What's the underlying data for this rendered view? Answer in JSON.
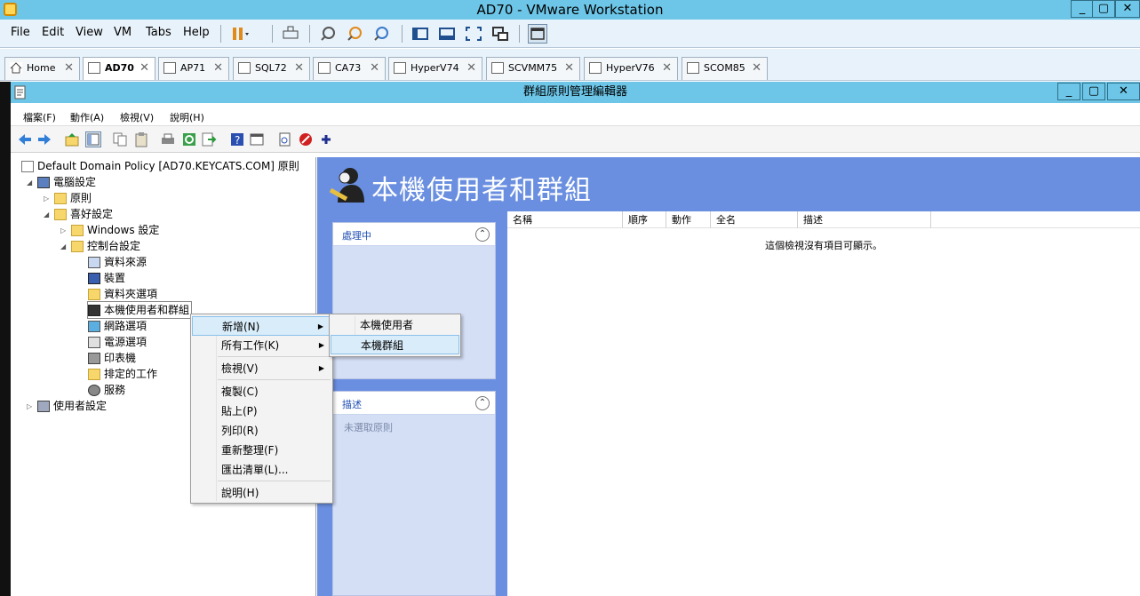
{
  "vmware": {
    "title": "AD70 - VMware Workstation",
    "window_controls": {
      "minimize": "_",
      "restore": "▢",
      "close": "✕"
    },
    "menu": [
      "File",
      "Edit",
      "View",
      "VM",
      "Tabs",
      "Help"
    ],
    "tabs": [
      {
        "label": "Home",
        "active": false
      },
      {
        "label": "AD70",
        "active": true
      },
      {
        "label": "AP71",
        "active": false
      },
      {
        "label": "SQL72",
        "active": false
      },
      {
        "label": "CA73",
        "active": false
      },
      {
        "label": "HyperV74",
        "active": false
      },
      {
        "label": "SCVMM75",
        "active": false
      },
      {
        "label": "HyperV76",
        "active": false
      },
      {
        "label": "SCOM85",
        "active": false
      }
    ],
    "tab_close": "✕"
  },
  "gpme": {
    "title": "群組原則管理編輯器",
    "menu": [
      "檔案(F)",
      "動作(A)",
      "檢視(V)",
      "說明(H)"
    ],
    "toolbar_icons": [
      "back-arrow-icon",
      "forward-arrow-icon",
      "up-folder-icon",
      "show-hide-tree-icon",
      "copy-icon",
      "paste-icon",
      "print-icon",
      "refresh-icon",
      "export-icon",
      "help-icon",
      "properties-icon",
      "new-page-icon",
      "stop-icon",
      "add-icon"
    ]
  },
  "tree": {
    "root": "Default Domain Policy [AD70.KEYCATS.COM] 原則",
    "computer_config": "電腦設定",
    "policies": "原則",
    "preferences": "喜好設定",
    "windows_settings": "Windows 設定",
    "control_panel": "控制台設定",
    "items": [
      "資料來源",
      "裝置",
      "資料夾選項",
      "本機使用者和群組",
      "網路選項",
      "電源選項",
      "印表機",
      "排定的工作",
      "服務"
    ],
    "user_config": "使用者設定"
  },
  "header": {
    "title": "本機使用者和群組"
  },
  "processing_panel": {
    "title": "處理中",
    "collapse": "⌃"
  },
  "description_panel": {
    "title": "描述",
    "collapse": "⌃",
    "text": "未選取原則"
  },
  "list": {
    "columns": [
      "名稱",
      "順序",
      "動作",
      "全名",
      "描述"
    ],
    "empty": "這個檢視沒有項目可顯示。"
  },
  "context_menu": {
    "new": "新增(N)",
    "all_tasks": "所有工作(K)",
    "view": "檢視(V)",
    "copy": "複製(C)",
    "paste": "貼上(P)",
    "print": "列印(R)",
    "refresh": "重新整理(F)",
    "export": "匯出清單(L)...",
    "help": "說明(H)"
  },
  "submenu": {
    "local_user": "本機使用者",
    "local_group": "本機群組"
  },
  "colors": {
    "titlebar": "#6dc6e8",
    "content_bg": "#6a8fe0",
    "panel_bg": "#d4def5",
    "highlight": "#d9ecfa"
  }
}
